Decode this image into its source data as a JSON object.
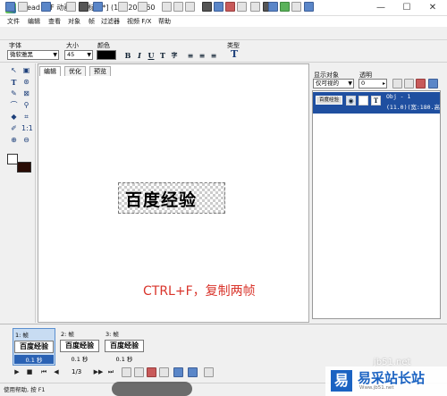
{
  "window": {
    "title": "Ulead GIF 动画 - [无标题*] (1X) 200x60",
    "controls": [
      "—",
      "☐",
      "✕"
    ]
  },
  "menu": [
    "文件",
    "编辑",
    "查看",
    "对象",
    "帧",
    "过滤器",
    "视频 F/X",
    "帮助"
  ],
  "propbar": {
    "font_label": "字体",
    "font_value": "微软雅黑",
    "size_label": "大小",
    "size_value": "45",
    "color_label": "颜色",
    "type_label": "类型",
    "text_color": "#000000",
    "format_buttons": [
      "B",
      "I",
      "U",
      "T",
      "字",
      "≡",
      "≡",
      "≡"
    ]
  },
  "tabs": [
    "编辑",
    "优化",
    "预览"
  ],
  "canvas": {
    "text": "百度经验",
    "annotation": "CTRL+F，复制两帧",
    "annotation_color": "#d9342b"
  },
  "objects": {
    "show_label": "显示对象",
    "show_value": "仅可视的",
    "opacity_label": "透明",
    "opacity_value": "0",
    "item": {
      "thumb": "百度经验",
      "line1": "Obj - 1",
      "line2": "(11.0)(宽:180.高"
    }
  },
  "frames": [
    {
      "num": "1: 帧",
      "thumb": "百度经验",
      "delay": "0.1 秒",
      "selected": true
    },
    {
      "num": "2: 帧",
      "thumb": "百度经验",
      "delay": "0.1 秒",
      "selected": false
    },
    {
      "num": "3: 帧",
      "thumb": "百度经验",
      "delay": "0.1 秒",
      "selected": false
    }
  ],
  "playback": {
    "counter": "1/3",
    "buttons": [
      "▶",
      "■",
      "⏮",
      "◀",
      "▶▶",
      "⏭"
    ]
  },
  "status": "使用帮助, 按 F1",
  "watermark": {
    "domain": "jb51.net",
    "logo": "易",
    "text": "易采站长站",
    "url": "Www.jb51.net"
  }
}
